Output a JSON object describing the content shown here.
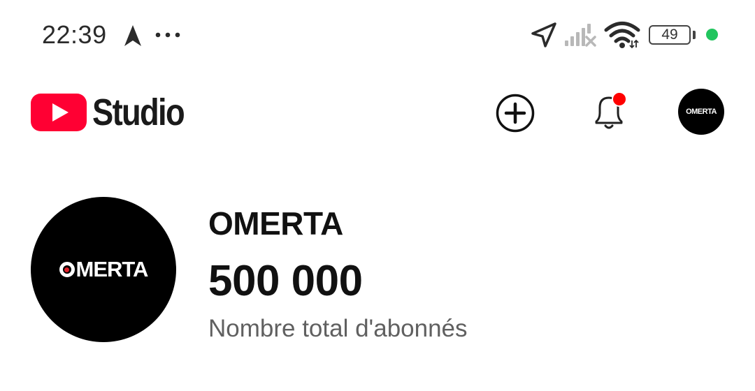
{
  "status_bar": {
    "time": "22:39",
    "battery_level": "49",
    "icons": [
      "navigation-arrow-icon",
      "more-dots-icon",
      "location-icon",
      "cellular-signal-off-icon",
      "wifi-icon",
      "battery-icon",
      "active-dot-indicator"
    ],
    "indicator_color": "#22c55e"
  },
  "header": {
    "brand_logo_icon": "youtube-play-logo",
    "brand_color": "#ff0033",
    "title": "Studio",
    "create_icon": "plus-circle-icon",
    "notifications_icon": "bell-icon",
    "notification_badge_color": "#ff0000",
    "avatar_label": "OMERTA"
  },
  "channel": {
    "avatar_label": "OMERTA",
    "name": "OMERTA",
    "subscriber_count": "500 000",
    "subscriber_label": "Nombre total d'abonnés"
  }
}
